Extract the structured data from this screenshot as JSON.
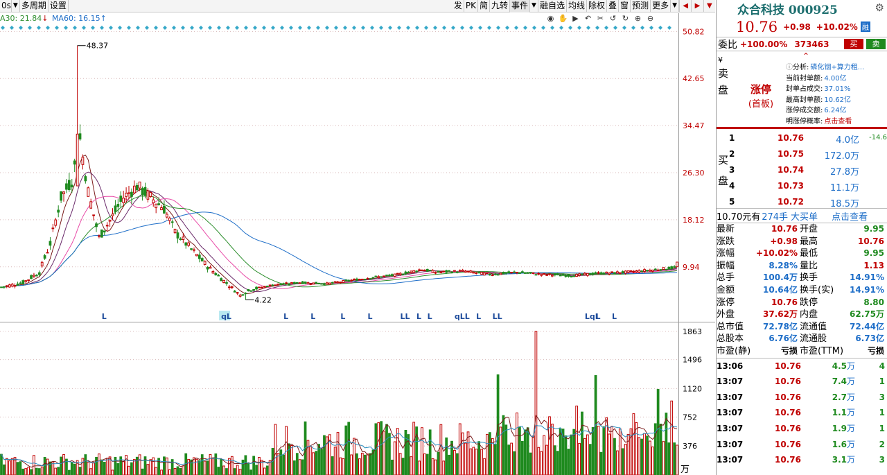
{
  "toolbar": {
    "left": [
      "0s",
      "多周期",
      "设置"
    ],
    "right": [
      "发",
      "PK",
      "简",
      "九转",
      "事件",
      "融自选",
      "均线",
      "除权",
      "叠",
      "窗",
      "预测",
      "更多"
    ],
    "nav": [
      "◀",
      "▶",
      "▼"
    ]
  },
  "ma_legend": {
    "ma30_label": "A30: 21.84",
    "ma30_arrow": "↓",
    "ma60_label": "MA60: 16.15",
    "ma60_arrow": "↑"
  },
  "colors": {
    "up": "#c00000",
    "down": "#1f8a1f",
    "ma5": "#7a1a1a",
    "ma10": "#6a2a6a",
    "ma20": "#e84ca8",
    "ma30": "#2f8f2f",
    "ma60": "#1e6ec8",
    "grid": "#d8b8b8",
    "diamond": "#35a8c8"
  },
  "chart_data": [
    {
      "type": "candlestick",
      "title": "",
      "y_ticks": [
        50.82,
        42.65,
        34.47,
        26.3,
        18.12,
        9.94
      ],
      "ylim": [
        1.0,
        54.0
      ],
      "annotations": [
        {
          "label": "48.37",
          "value": 48.37,
          "index": 28,
          "kind": "high"
        },
        {
          "label": "4.22",
          "value": 4.22,
          "index": 90,
          "kind": "low"
        }
      ],
      "signals": [
        {
          "label": "L",
          "index": 38
        },
        {
          "label": "qL",
          "index": 82
        },
        {
          "label": "L",
          "index": 105
        },
        {
          "label": "L",
          "index": 115
        },
        {
          "label": "L",
          "index": 126
        },
        {
          "label": "L",
          "index": 136
        },
        {
          "label": "LL",
          "index": 148
        },
        {
          "label": "L",
          "index": 154
        },
        {
          "label": "L",
          "index": 158
        },
        {
          "label": "qLL",
          "index": 168
        },
        {
          "label": "L",
          "index": 176
        },
        {
          "label": "LL",
          "index": 182
        },
        {
          "label": "LqL",
          "index": 216
        },
        {
          "label": "L",
          "index": 220
        },
        {
          "label": "L",
          "index": 226
        }
      ],
      "series": [
        {
          "name": "price",
          "open": [],
          "high": [],
          "low": [],
          "close": []
        }
      ]
    },
    {
      "type": "bar",
      "title": "",
      "unit_label": "万",
      "y_ticks": [
        1863,
        1496,
        1120,
        752,
        376
      ],
      "ylim": [
        0,
        1960
      ],
      "highlight": [
        {
          "index": 183,
          "value": 1300,
          "dir": "down"
        },
        {
          "index": 197,
          "value": 1863,
          "dir": "up"
        },
        {
          "index": 219,
          "value": 1290,
          "dir": "down"
        },
        {
          "index": 242,
          "value": 1110,
          "dir": "down"
        },
        {
          "index": 247,
          "value": 960,
          "dir": "up"
        }
      ],
      "series": [
        {
          "name": "volume",
          "values": []
        }
      ]
    }
  ],
  "panel": {
    "stock_name": "众合科技 000925",
    "price": "10.76",
    "change": "+0.98",
    "change_pct": "+10.02%",
    "tag": "融",
    "weibi_label": "委比",
    "weibi_pct": "+100.00%",
    "weibi_val": "373463",
    "buy_btn": "买",
    "sell_btn": "卖",
    "sell_side": [
      "¥",
      "卖",
      "盘"
    ],
    "limit_up": "涨停",
    "first_board": "(首板)",
    "analysis": [
      {
        "k": "分析:",
        "v": "磷化铟+算力租..."
      },
      {
        "k": "当前封单额:",
        "v": "4.00亿"
      },
      {
        "k": "封单占成交:",
        "v": "37.01%"
      },
      {
        "k": "最高封单额:",
        "v": "10.62亿"
      },
      {
        "k": "涨停成交额:",
        "v": "6.24亿"
      },
      {
        "k": "明涨停概率:",
        "v": "点击查看",
        "red": true
      }
    ],
    "buy_side": [
      "买",
      "盘"
    ],
    "buy_levels": [
      {
        "n": "1",
        "p": "10.76",
        "q": "4.0",
        "u": "亿",
        "d": "-14.6"
      },
      {
        "n": "2",
        "p": "10.75",
        "q": "172.0",
        "u": "万",
        "d": ""
      },
      {
        "n": "3",
        "p": "10.74",
        "q": "27.8",
        "u": "万",
        "d": ""
      },
      {
        "n": "4",
        "p": "10.73",
        "q": "11.1",
        "u": "万",
        "d": ""
      },
      {
        "n": "5",
        "p": "10.72",
        "q": "18.5",
        "u": "万",
        "d": ""
      }
    ],
    "big_order": {
      "a": "10.70元有",
      "b": "274手",
      "c": "大买单",
      "d": "点击查看"
    },
    "quote": [
      {
        "k": "最新",
        "v": "10.76",
        "vc": "red",
        "k2": "开盘",
        "v2": "9.95",
        "v2c": "grn"
      },
      {
        "k": "涨跌",
        "v": "+0.98",
        "vc": "red",
        "k2": "最高",
        "v2": "10.76",
        "v2c": "red"
      },
      {
        "k": "涨幅",
        "v": "+10.02%",
        "vc": "red",
        "k2": "最低",
        "v2": "9.95",
        "v2c": "grn"
      },
      {
        "k": "振幅",
        "v": "8.28%",
        "vc": "blu",
        "k2": "量比",
        "v2": "1.13",
        "v2c": "red"
      },
      {
        "k": "总手",
        "v": "100.4万",
        "vc": "blu",
        "k2": "换手",
        "v2": "14.91%",
        "v2c": "blu"
      },
      {
        "k": "金额",
        "v": "10.64亿",
        "vc": "blu",
        "k2": "换手(实)",
        "v2": "14.91%",
        "v2c": "blu"
      },
      {
        "k": "涨停",
        "v": "10.76",
        "vc": "red",
        "k2": "跌停",
        "v2": "8.80",
        "v2c": "grn"
      },
      {
        "k": "外盘",
        "v": "37.62万",
        "vc": "red",
        "k2": "内盘",
        "v2": "62.75万",
        "v2c": "grn"
      },
      {
        "k": "总市值",
        "v": "72.78亿",
        "vc": "blu",
        "k2": "流通值",
        "v2": "72.44亿",
        "v2c": "blu"
      },
      {
        "k": "总股本",
        "v": "6.76亿",
        "vc": "blu",
        "k2": "流通股",
        "v2": "6.73亿",
        "v2c": "blu"
      },
      {
        "k": "市盈(静)",
        "v": "亏损",
        "vc": "blk",
        "k2": "市盈(TTM)",
        "v2": "亏损",
        "v2c": "blk"
      }
    ],
    "ticks": [
      {
        "t": "13:06",
        "p": "10.76",
        "q": "4.5",
        "u": "万",
        "c": "4"
      },
      {
        "t": "13:07",
        "p": "10.76",
        "q": "7.4",
        "u": "万",
        "c": "1"
      },
      {
        "t": "13:07",
        "p": "10.76",
        "q": "2.7",
        "u": "万",
        "c": "3"
      },
      {
        "t": "13:07",
        "p": "10.76",
        "q": "1.1",
        "u": "万",
        "c": "1"
      },
      {
        "t": "13:07",
        "p": "10.76",
        "q": "1.9",
        "u": "万",
        "c": "1"
      },
      {
        "t": "13:07",
        "p": "10.76",
        "q": "1.6",
        "u": "万",
        "c": "2"
      },
      {
        "t": "13:07",
        "p": "10.76",
        "q": "3.1",
        "u": "万",
        "c": "3"
      }
    ]
  }
}
